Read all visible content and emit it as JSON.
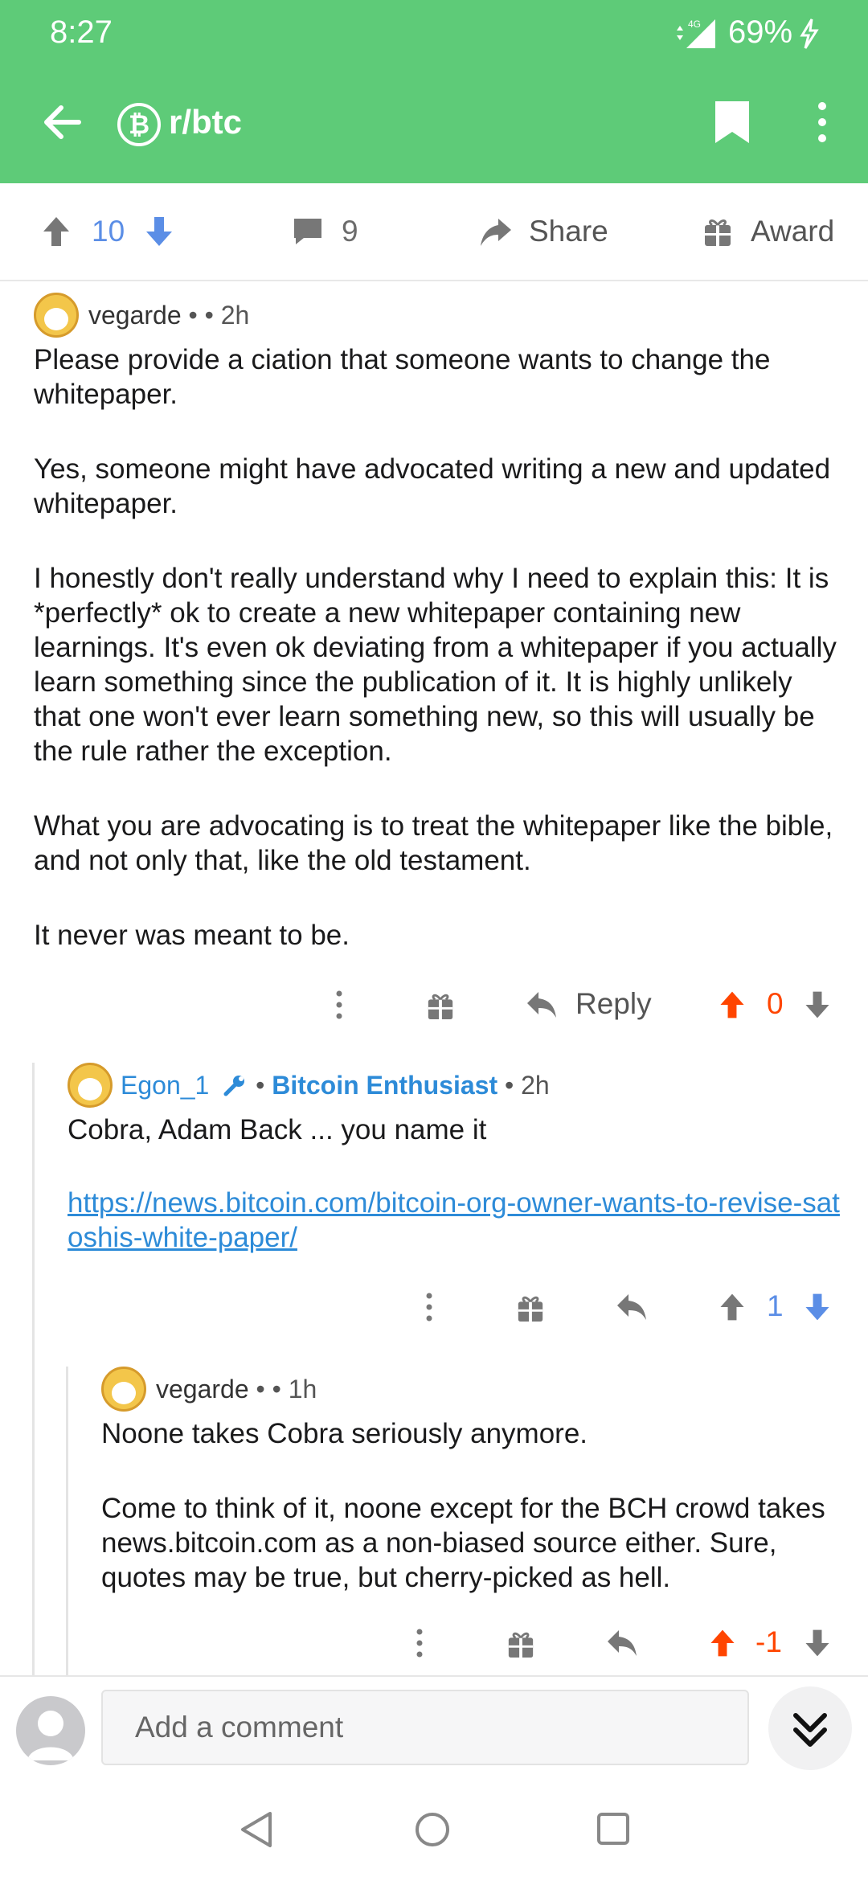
{
  "status_bar": {
    "time": "8:27",
    "network": "4G",
    "battery": "69%"
  },
  "toolbar": {
    "subreddit": "r/btc",
    "subreddit_icon": "₿"
  },
  "post_actions": {
    "upvotes": "10",
    "comments": "9",
    "share": "Share",
    "award": "Award"
  },
  "comments": [
    {
      "author": "vegarde",
      "sep": "•",
      "time": "• 2h",
      "paragraphs": [
        "Please provide a ciation that someone wants to change the whitepaper.",
        "Yes, someone might have advocated writing a new and updated whitepaper.",
        "I honestly don't really understand why I need to explain this: It is *perfectly* ok to create a new whitepaper containing new learnings. It's even ok deviating from a whitepaper if you actually learn something since the publication of it. It is highly unlikely that one won't ever learn something new, so this will usually be the rule rather the exception.",
        "What you are advocating is to treat the whitepaper like the bible, and not only that, like the old testament.",
        "It never was meant to be."
      ],
      "reply_label": "Reply",
      "score": "0"
    },
    {
      "author": "Egon_1",
      "flair": "Bitcoin Enthusiast",
      "time": "• 2h",
      "paragraphs": [
        "Cobra, Adam Back ... you name it"
      ],
      "link": "https://news.bitcoin.com/bitcoin-org-owner-wants-to-revise-satoshis-white-paper/",
      "score": "1"
    },
    {
      "author": "vegarde",
      "sep": "•",
      "time": "• 1h",
      "paragraphs": [
        "Noone takes Cobra seriously anymore.",
        "Come to think of it, noone except for the BCH crowd takes news.bitcoin.com as a non-biased source either. Sure, quotes may be true, but cherry-picked as hell."
      ],
      "score": "-1"
    }
  ],
  "composer": {
    "placeholder": "Add a comment"
  },
  "colors": {
    "header": "#5ecb78",
    "upvote": "#ff4500",
    "downvote": "#5b8ee6",
    "link": "#2d8bd8"
  }
}
